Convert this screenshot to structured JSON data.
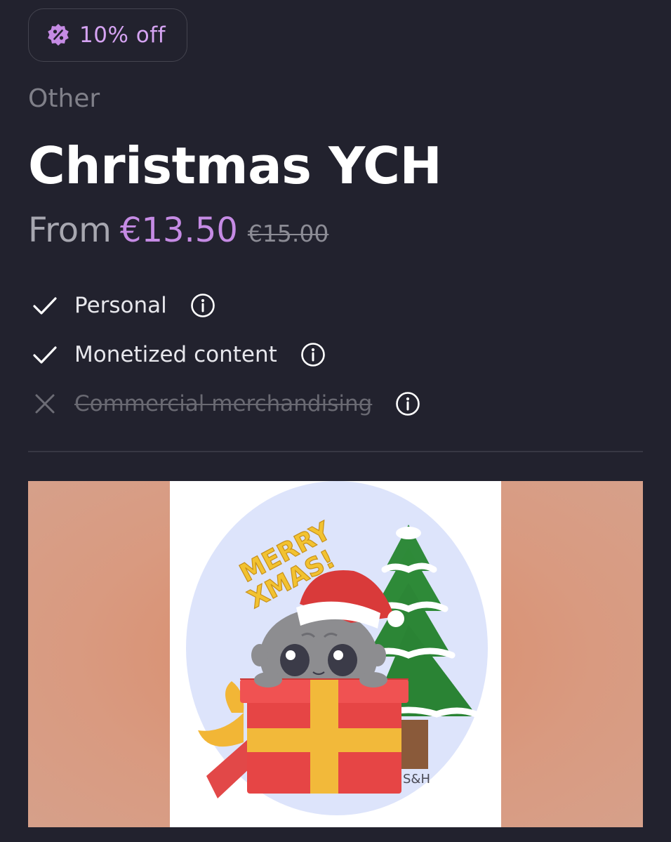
{
  "discount": {
    "label": "10% off",
    "icon": "percent-badge-icon",
    "color": "#c58be4"
  },
  "category": "Other",
  "title": "Christmas YCH",
  "price": {
    "prefix": "From",
    "current": "€13.50",
    "original": "€15.00"
  },
  "licenses": [
    {
      "label": "Personal",
      "included": true,
      "icon": "check-icon"
    },
    {
      "label": "Monetized content",
      "included": true,
      "icon": "check-icon"
    },
    {
      "label": "Commercial merchandising",
      "included": false,
      "icon": "x-icon"
    }
  ],
  "artwork": {
    "greeting_line1": "MERRY",
    "greeting_line2": "XMAS!",
    "signature": "S&H",
    "description": "Chibi character in a Santa hat peeking out of a red gift box next to a snowy Christmas tree"
  },
  "colors": {
    "background": "#22222e",
    "accent": "#c58be4",
    "muted": "#808089"
  }
}
